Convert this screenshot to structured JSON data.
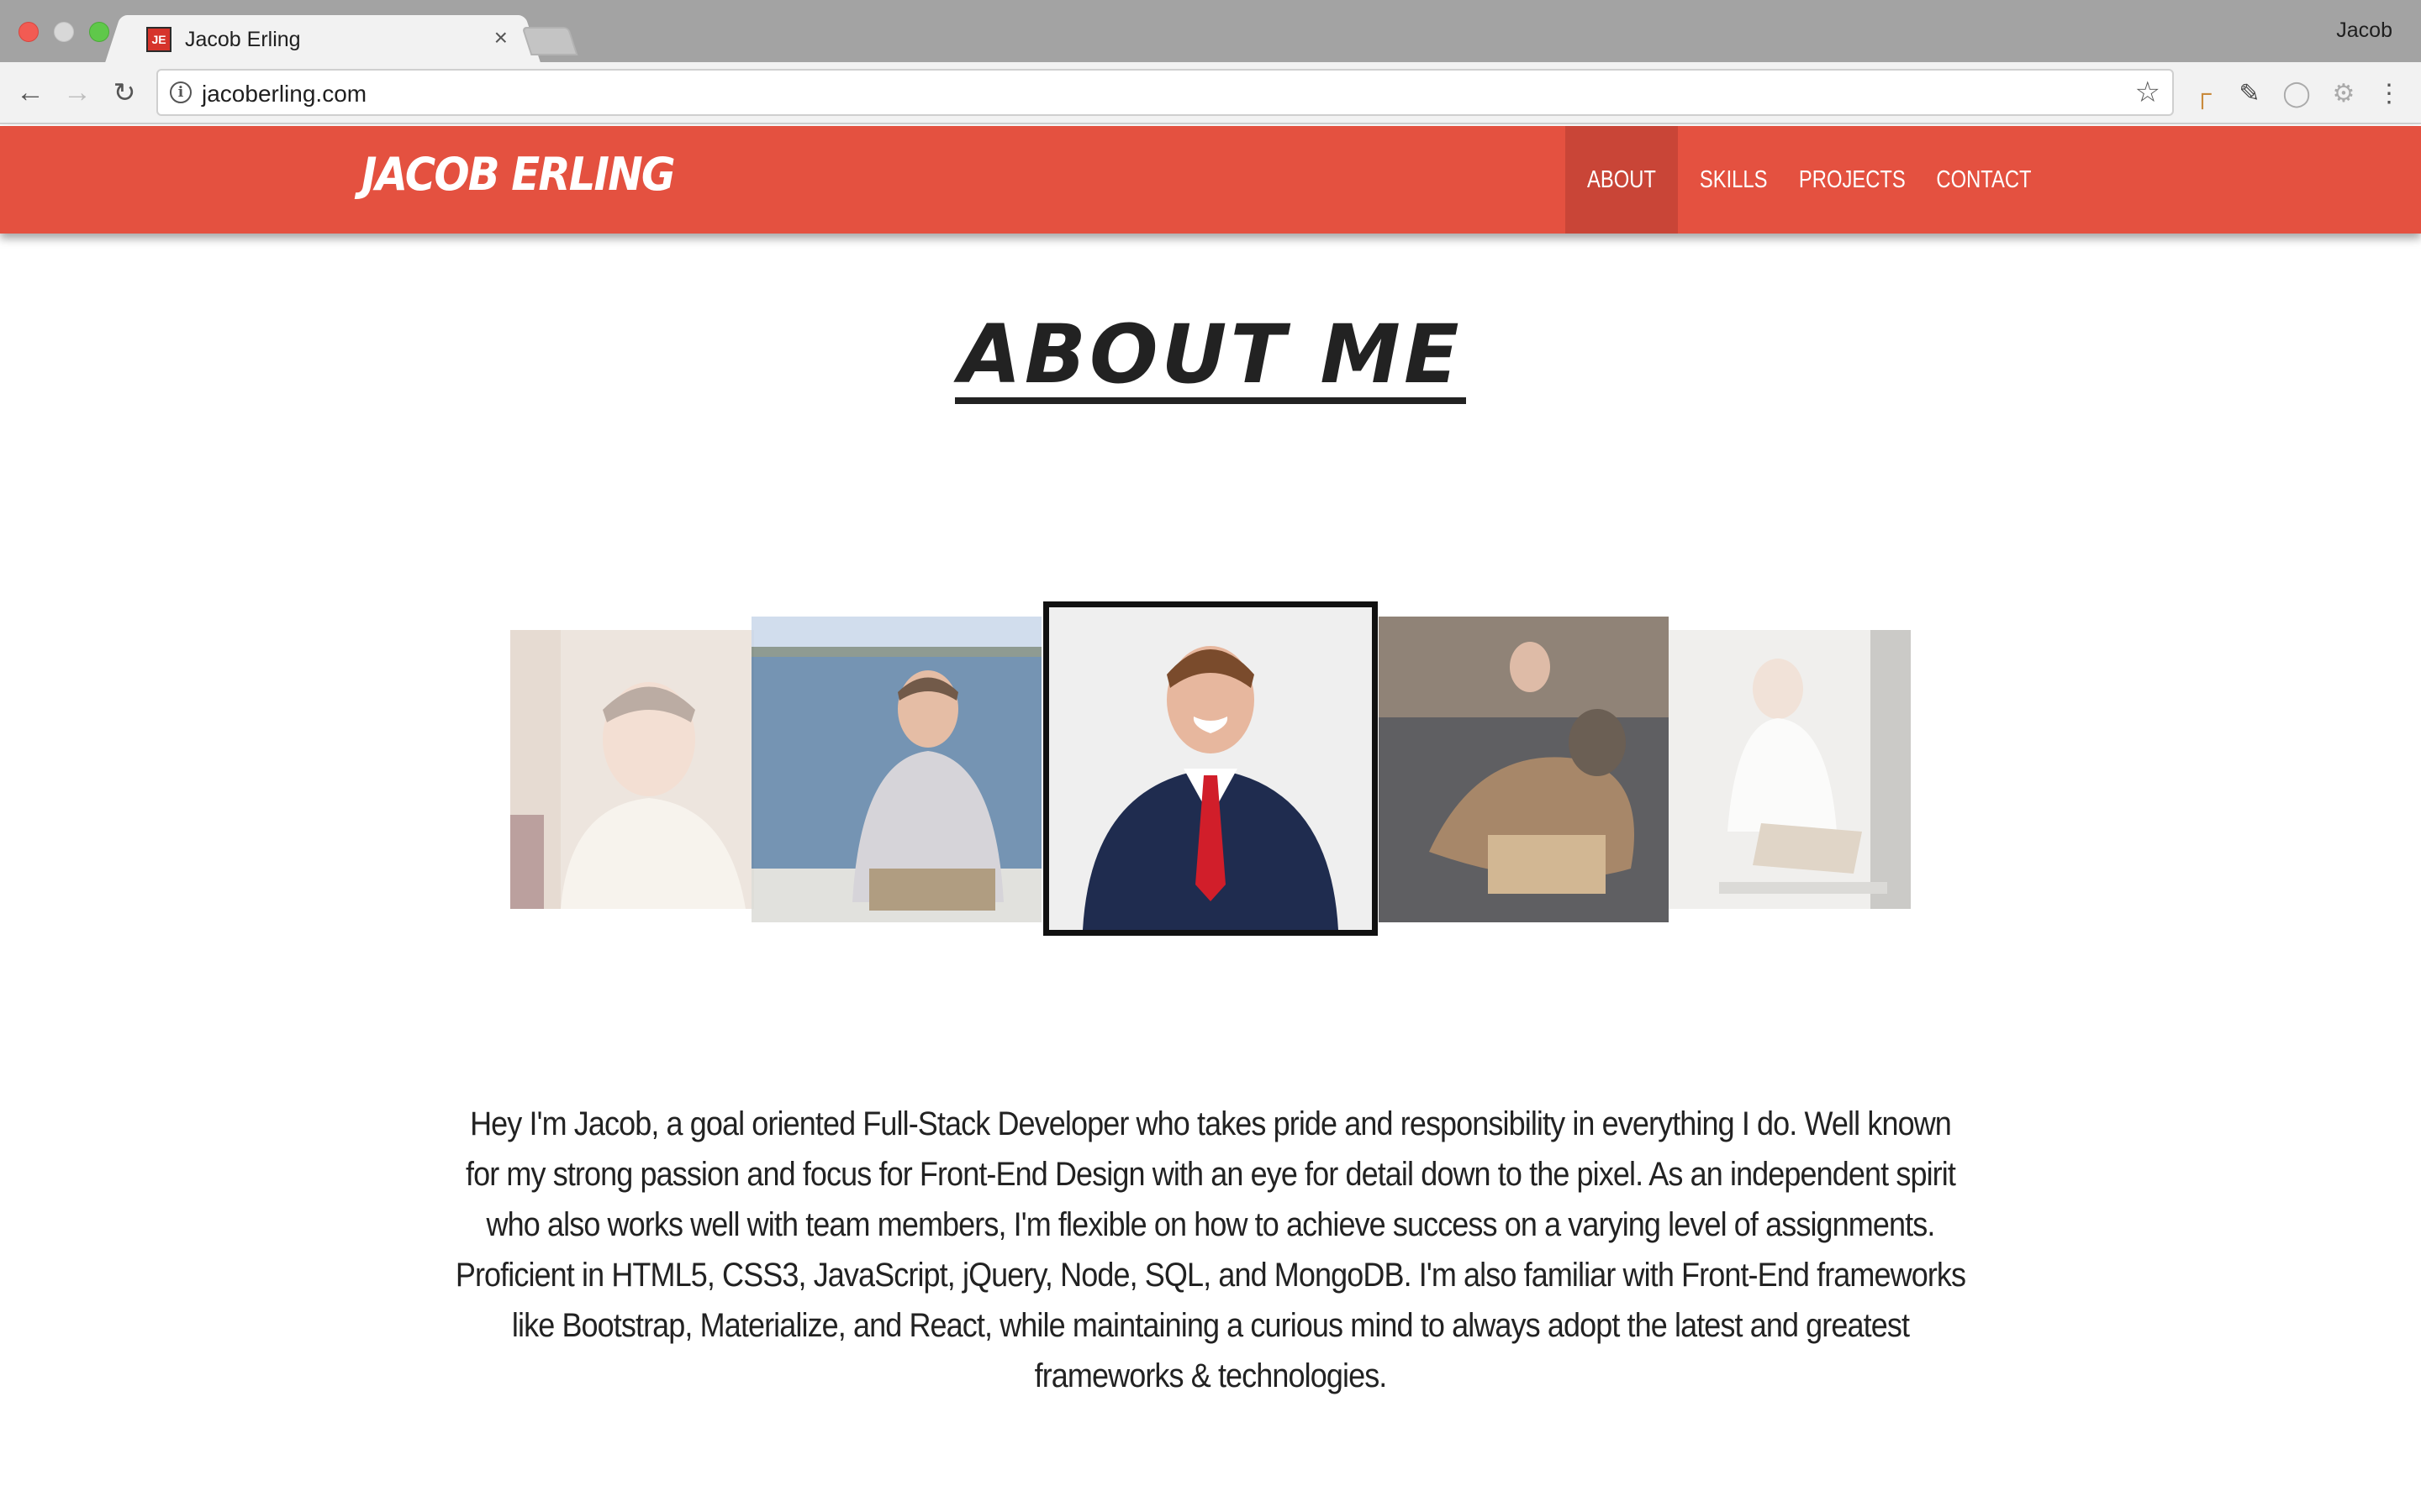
{
  "browser": {
    "tab_title": "Jacob Erling",
    "favicon_text": "JE",
    "close_glyph": "×",
    "profile_name": "Jacob",
    "url": "jacoberling.com",
    "icons": {
      "back": "arrow-left-icon",
      "forward": "arrow-right-icon",
      "reload": "reload-icon",
      "info": "info-icon",
      "star": "star-icon"
    }
  },
  "site": {
    "logo": "JACOB ERLING",
    "brand_color": "#e45140",
    "nav": [
      {
        "label": "ABOUT",
        "active": true
      },
      {
        "label": "SKILLS",
        "active": false
      },
      {
        "label": "PROJECTS",
        "active": false
      },
      {
        "label": "CONTACT",
        "active": false
      }
    ]
  },
  "about": {
    "title": "ABOUT ME",
    "carousel": [
      {
        "name": "photo-hoodie",
        "active": false
      },
      {
        "name": "photo-waterfront",
        "active": false
      },
      {
        "name": "photo-suit",
        "active": true
      },
      {
        "name": "photo-dog-couch",
        "active": false
      },
      {
        "name": "photo-sitting-outdoors",
        "active": false
      }
    ],
    "bio": "Hey I'm Jacob, a goal oriented Full-Stack Developer who takes pride and responsibility in everything I do. Well known for my strong passion and focus for Front-End Design with an eye for detail down to the pixel. As an independent spirit who also works well with team members, I'm flexible on how to achieve success on a varying level of assignments. Proficient in HTML5, CSS3, JavaScript, jQuery, Node, SQL, and MongoDB. I'm also familiar with Front-End frameworks like Bootstrap, Materialize, and React, while maintaining a curious mind to always adopt the latest and greatest frameworks & technologies."
  }
}
